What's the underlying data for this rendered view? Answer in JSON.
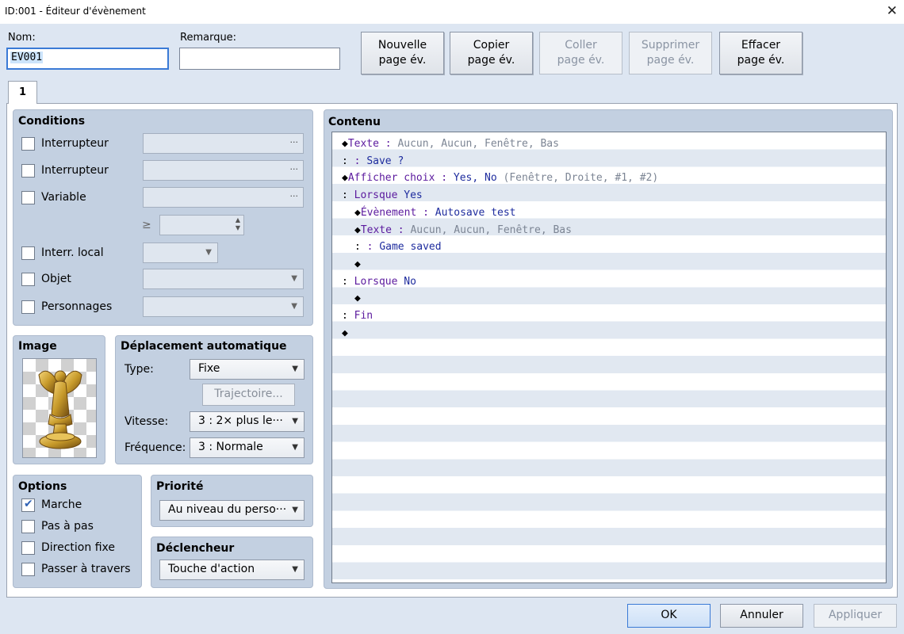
{
  "window": {
    "title": "ID:001 - Éditeur d'évènement"
  },
  "header": {
    "name_label": "Nom:",
    "name_value": "EV001",
    "remark_label": "Remarque:",
    "remark_value": ""
  },
  "toolbar": [
    {
      "line1": "Nouvelle",
      "line2": "page év.",
      "enabled": true
    },
    {
      "line1": "Copier",
      "line2": "page év.",
      "enabled": true
    },
    {
      "line1": "Coller",
      "line2": "page év.",
      "enabled": false
    },
    {
      "line1": "Supprimer",
      "line2": "page év.",
      "enabled": false
    },
    {
      "line1": "Effacer",
      "line2": "page év.",
      "enabled": true
    }
  ],
  "tabs": [
    {
      "label": "1"
    }
  ],
  "conditions": {
    "title": "Conditions",
    "switch1_label": "Interrupteur",
    "switch2_label": "Interrupteur",
    "variable_label": "Variable",
    "gte_symbol": "≥",
    "self_switch_label": "Interr. local",
    "item_label": "Objet",
    "actor_label": "Personnages",
    "dots": "···"
  },
  "image": {
    "title": "Image",
    "icon": "golden-angel-statue-icon"
  },
  "autonomous": {
    "title": "Déplacement automatique",
    "type_label": "Type:",
    "type_value": "Fixe",
    "route_button": "Trajectoire...",
    "speed_label": "Vitesse:",
    "speed_value": "3 : 2× plus le···",
    "freq_label": "Fréquence:",
    "freq_value": "3 : Normale"
  },
  "options": {
    "title": "Options",
    "walking": {
      "label": "Marche",
      "checked": true
    },
    "stepping": {
      "label": "Pas à pas",
      "checked": false
    },
    "direction_fix": {
      "label": "Direction fixe",
      "checked": false
    },
    "through": {
      "label": "Passer à travers",
      "checked": false
    }
  },
  "priority": {
    "title": "Priorité",
    "value": "Au niveau du perso···"
  },
  "trigger": {
    "title": "Déclencheur",
    "value": "Touche d'action"
  },
  "contents": {
    "title": "Contenu",
    "lines": [
      {
        "indent": 0,
        "prefix": "◆",
        "cmd": "Texte",
        "sep": " : ",
        "arg": "",
        "gray": "Aucun, Aucun, Fenêtre, Bas"
      },
      {
        "indent": 0,
        "prefix": " :",
        "cmd": "",
        "sep": "      : ",
        "arg": "Save ?",
        "gray": ""
      },
      {
        "indent": 0,
        "prefix": "◆",
        "cmd": "Afficher choix",
        "sep": " : ",
        "arg": "Yes, No ",
        "gray": "(Fenêtre, Droite, #1, #2)"
      },
      {
        "indent": 0,
        "prefix": " : ",
        "cmd": "Lorsque",
        "sep": " ",
        "arg": "Yes",
        "gray": ""
      },
      {
        "indent": 1,
        "prefix": "◆",
        "cmd": "Évènement",
        "sep": " : ",
        "arg": "Autosave test",
        "gray": ""
      },
      {
        "indent": 1,
        "prefix": "◆",
        "cmd": "Texte",
        "sep": " : ",
        "arg": "",
        "gray": "Aucun, Aucun, Fenêtre, Bas"
      },
      {
        "indent": 1,
        "prefix": " :",
        "cmd": "",
        "sep": "      : ",
        "arg": "Game saved",
        "gray": ""
      },
      {
        "indent": 1,
        "prefix": "◆",
        "cmd": "",
        "sep": "",
        "arg": "",
        "gray": ""
      },
      {
        "indent": 0,
        "prefix": " : ",
        "cmd": "Lorsque",
        "sep": " ",
        "arg": "No",
        "gray": ""
      },
      {
        "indent": 1,
        "prefix": "◆",
        "cmd": "",
        "sep": "",
        "arg": "",
        "gray": ""
      },
      {
        "indent": 0,
        "prefix": " : ",
        "cmd": "Fin",
        "sep": "",
        "arg": "",
        "gray": ""
      },
      {
        "indent": 0,
        "prefix": "◆",
        "cmd": "",
        "sep": "",
        "arg": "",
        "gray": ""
      }
    ]
  },
  "footer": {
    "ok": "OK",
    "cancel": "Annuler",
    "apply": "Appliquer"
  }
}
